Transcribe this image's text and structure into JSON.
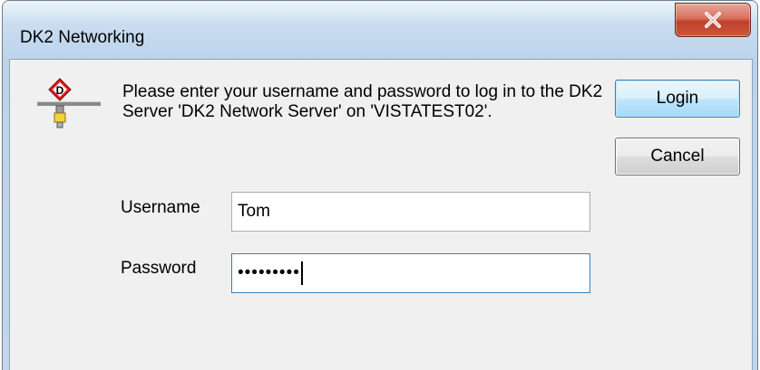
{
  "window": {
    "title": "DK2 Networking",
    "close_glyph": "X"
  },
  "dialog": {
    "message": "Please enter your username and password to log in to the DK2 Server 'DK2 Network Server' on 'VISTATEST02'.",
    "app_icon": "dk2-network-icon"
  },
  "form": {
    "username_label": "Username",
    "username_value": "Tom",
    "password_label": "Password",
    "password_masked": "•••••••••"
  },
  "buttons": {
    "login": "Login",
    "cancel": "Cancel"
  },
  "colors": {
    "titlebar": "#c4d9ee",
    "client_background": "#f0f0f0",
    "close_button": "#c9563e",
    "default_button_border": "#3c7fb1"
  }
}
